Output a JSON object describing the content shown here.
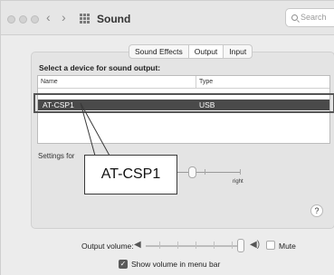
{
  "window": {
    "title": "Sound",
    "search_placeholder": "Search"
  },
  "tabs": [
    {
      "label": "Sound Effects",
      "selected": false
    },
    {
      "label": "Output",
      "selected": true
    },
    {
      "label": "Input",
      "selected": false
    }
  ],
  "output": {
    "select_label": "Select a device for sound output:",
    "columns": [
      "Name",
      "Type"
    ],
    "devices": [
      {
        "name": "AT-CSP1",
        "type": "USB",
        "selected": true
      }
    ],
    "settings_label": "Settings for",
    "balance_right_label": "right",
    "balance_level": 0.3
  },
  "callout": {
    "text": "AT-CSP1"
  },
  "footer": {
    "output_volume_label": "Output volume:",
    "volume_level": 0.95,
    "mute_label": "Mute",
    "mute_checked": false,
    "show_volume_label": "Show volume in menu bar",
    "show_volume_checked": true
  },
  "help_label": "?"
}
